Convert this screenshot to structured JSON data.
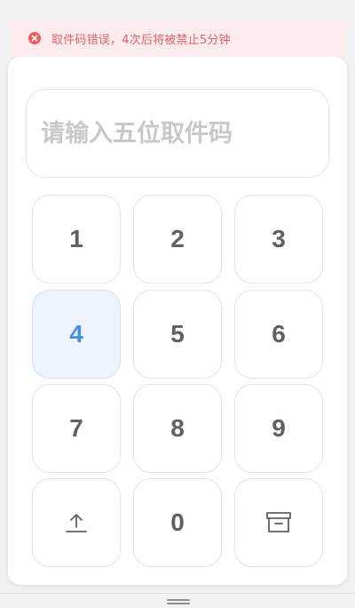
{
  "alert": {
    "icon": "error-circle-icon",
    "message": "取件码错误，4次后将被禁止5分钟",
    "color": "#ef5d62"
  },
  "code_input": {
    "placeholder": "请输入五位取件码",
    "value": ""
  },
  "keypad": {
    "keys": [
      "1",
      "2",
      "3",
      "4",
      "5",
      "6",
      "7",
      "8",
      "9"
    ],
    "zero": "0",
    "active_key": "4",
    "active_color": "#4a90e2",
    "left_icon": "upload-icon",
    "right_icon": "archive-box-icon"
  },
  "bottom_bar": {
    "icon": "drag-handle-icon"
  }
}
